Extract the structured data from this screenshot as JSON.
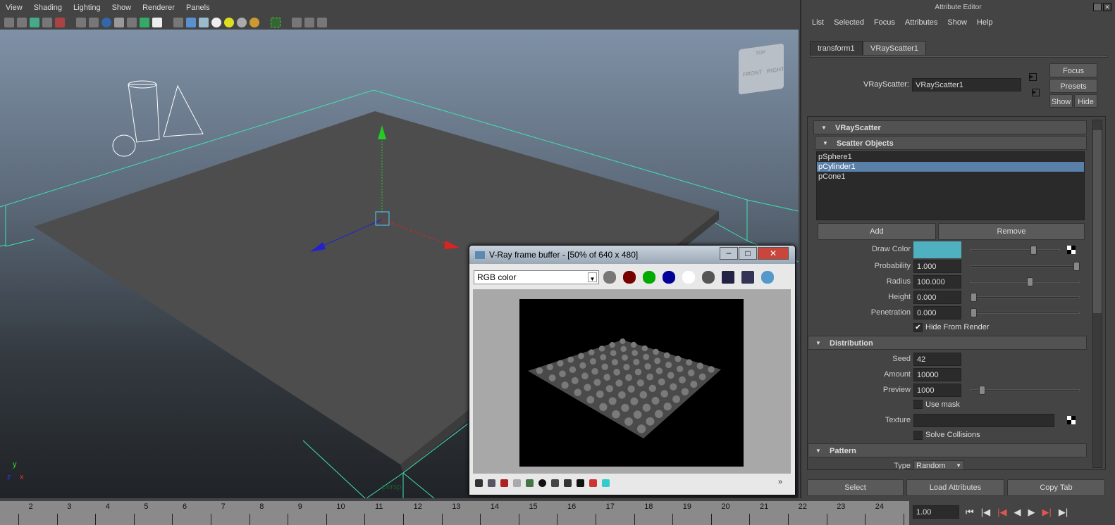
{
  "menubar": {
    "items": [
      "View",
      "Shading",
      "Lighting",
      "Show",
      "Renderer",
      "Panels"
    ]
  },
  "viewport": {
    "camera_label": "persp",
    "axis": {
      "y": "y",
      "z": "z",
      "x": "x"
    },
    "viewcube": {
      "top": "TOP",
      "front": "FRONT",
      "right": "RIGHT"
    }
  },
  "attribute_editor": {
    "title": "Attribute Editor",
    "menu": [
      "List",
      "Selected",
      "Focus",
      "Attributes",
      "Show",
      "Help"
    ],
    "tabs": [
      {
        "label": "transform1",
        "active": false
      },
      {
        "label": "VRayScatter1",
        "active": true
      }
    ],
    "node_label": "VRayScatter:",
    "node_value": "VRayScatter1",
    "buttons": {
      "focus": "Focus",
      "presets": "Presets",
      "show": "Show",
      "hide": "Hide"
    },
    "sections": {
      "main": "VRayScatter",
      "scatter_objects": "Scatter Objects",
      "distribution": "Distribution",
      "pattern": "Pattern"
    },
    "scatter_list": [
      "pSphere1",
      "pCylinder1",
      "pCone1"
    ],
    "selected_item": "pCylinder1",
    "add": "Add",
    "remove": "Remove",
    "draw_color": {
      "label": "Draw Color",
      "color": "#4fb0c0",
      "slider": 0.72
    },
    "probability": {
      "label": "Probability",
      "value": "1.000",
      "slider": 1.0
    },
    "radius": {
      "label": "Radius",
      "value": "100.000",
      "slider": 0.55
    },
    "height": {
      "label": "Height",
      "value": "0.000",
      "slider": 0
    },
    "penetration": {
      "label": "Penetration",
      "value": "0.000",
      "slider": 0
    },
    "hide_from_render": {
      "label": "Hide From Render",
      "checked": true
    },
    "seed": {
      "label": "Seed",
      "value": "42"
    },
    "amount": {
      "label": "Amount",
      "value": "10000"
    },
    "preview": {
      "label": "Preview",
      "value": "1000",
      "slider": 0.08
    },
    "use_mask": {
      "label": "Use mask",
      "checked": false
    },
    "texture": {
      "label": "Texture",
      "value": ""
    },
    "solve_collisions": {
      "label": "Solve Collisions",
      "checked": false
    },
    "type": {
      "label": "Type",
      "value": "Random"
    },
    "bottom": {
      "select": "Select",
      "load": "Load Attributes",
      "copy": "Copy Tab"
    }
  },
  "frame_buffer": {
    "title": "V-Ray frame buffer - [50% of 640 x 480]",
    "channel": "RGB color"
  },
  "timeline": {
    "ticks": [
      "2",
      "3",
      "4",
      "5",
      "6",
      "7",
      "8",
      "9",
      "10",
      "11",
      "12",
      "13",
      "14",
      "15",
      "16",
      "17",
      "18",
      "19",
      "20",
      "21",
      "22",
      "23",
      "24"
    ],
    "current_time": "1.00"
  }
}
